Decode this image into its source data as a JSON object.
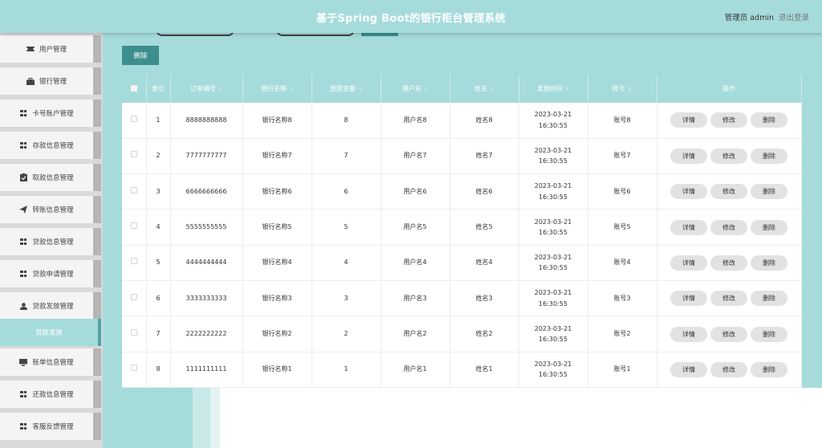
{
  "header": {
    "title": "基于Spring Boot的银行柜台管理系统",
    "user": "管理员 admin",
    "logout": "退出登录"
  },
  "sidebar": {
    "items": [
      {
        "label": "用户管理",
        "icon": "ticket-icon"
      },
      {
        "label": "银行管理",
        "icon": "briefcase-icon"
      },
      {
        "label": "卡号账户管理",
        "icon": "grid-icon"
      },
      {
        "label": "存款信息管理",
        "icon": "grid-icon"
      },
      {
        "label": "取款信息管理",
        "icon": "clipboard-check-icon"
      },
      {
        "label": "转账信息管理",
        "icon": "paper-plane-icon"
      },
      {
        "label": "贷款信息管理",
        "icon": "grid-icon"
      },
      {
        "label": "贷款申请管理",
        "icon": "grid-icon"
      },
      {
        "label": "贷款发放管理",
        "icon": "user-icon"
      },
      {
        "label": "贷款发放",
        "icon": "",
        "submenu": true
      },
      {
        "label": "账单信息管理",
        "icon": "monitor-icon"
      },
      {
        "label": "还款信息管理",
        "icon": "grid-icon"
      },
      {
        "label": "客服反馈管理",
        "icon": "grid-icon"
      }
    ]
  },
  "toolbar": {
    "delete_label": "删除"
  },
  "table": {
    "headers": [
      "索引",
      "订单编号",
      "银行名称",
      "放款金额",
      "用户名",
      "姓名",
      "发放时间",
      "账号",
      "操作"
    ],
    "rows": [
      {
        "idx": "1",
        "order": "8888888888",
        "bank": "银行名称8",
        "amount": "8",
        "username": "用户名8",
        "name": "姓名8",
        "time": "2023-03-21 16:30:55",
        "account": "账号8"
      },
      {
        "idx": "2",
        "order": "7777777777",
        "bank": "银行名称7",
        "amount": "7",
        "username": "用户名7",
        "name": "姓名7",
        "time": "2023-03-21 16:30:55",
        "account": "账号7"
      },
      {
        "idx": "3",
        "order": "6666666666",
        "bank": "银行名称6",
        "amount": "6",
        "username": "用户名6",
        "name": "姓名6",
        "time": "2023-03-21 16:30:55",
        "account": "账号6"
      },
      {
        "idx": "4",
        "order": "5555555555",
        "bank": "银行名称5",
        "amount": "5",
        "username": "用户名5",
        "name": "姓名5",
        "time": "2023-03-21 16:30:55",
        "account": "账号5"
      },
      {
        "idx": "5",
        "order": "4444444444",
        "bank": "银行名称4",
        "amount": "4",
        "username": "用户名4",
        "name": "姓名4",
        "time": "2023-03-21 16:30:55",
        "account": "账号4"
      },
      {
        "idx": "6",
        "order": "3333333333",
        "bank": "银行名称3",
        "amount": "3",
        "username": "用户名3",
        "name": "姓名3",
        "time": "2023-03-21 16:30:55",
        "account": "账号3"
      },
      {
        "idx": "7",
        "order": "2222222222",
        "bank": "银行名称2",
        "amount": "2",
        "username": "用户名2",
        "name": "姓名2",
        "time": "2023-03-21 16:30:55",
        "account": "账号2"
      },
      {
        "idx": "8",
        "order": "1111111111",
        "bank": "银行名称1",
        "amount": "1",
        "username": "用户名1",
        "name": "姓名1",
        "time": "2023-03-21 16:30:55",
        "account": "账号1"
      }
    ],
    "actions": {
      "detail": "详情",
      "edit": "修改",
      "delete": "删除"
    }
  },
  "colors": {
    "primary": "#a6dbdb",
    "accent": "#3d8e8e",
    "sidebar_bg": "#f4f4f4",
    "sidebar_border": "#b6b6b6"
  }
}
